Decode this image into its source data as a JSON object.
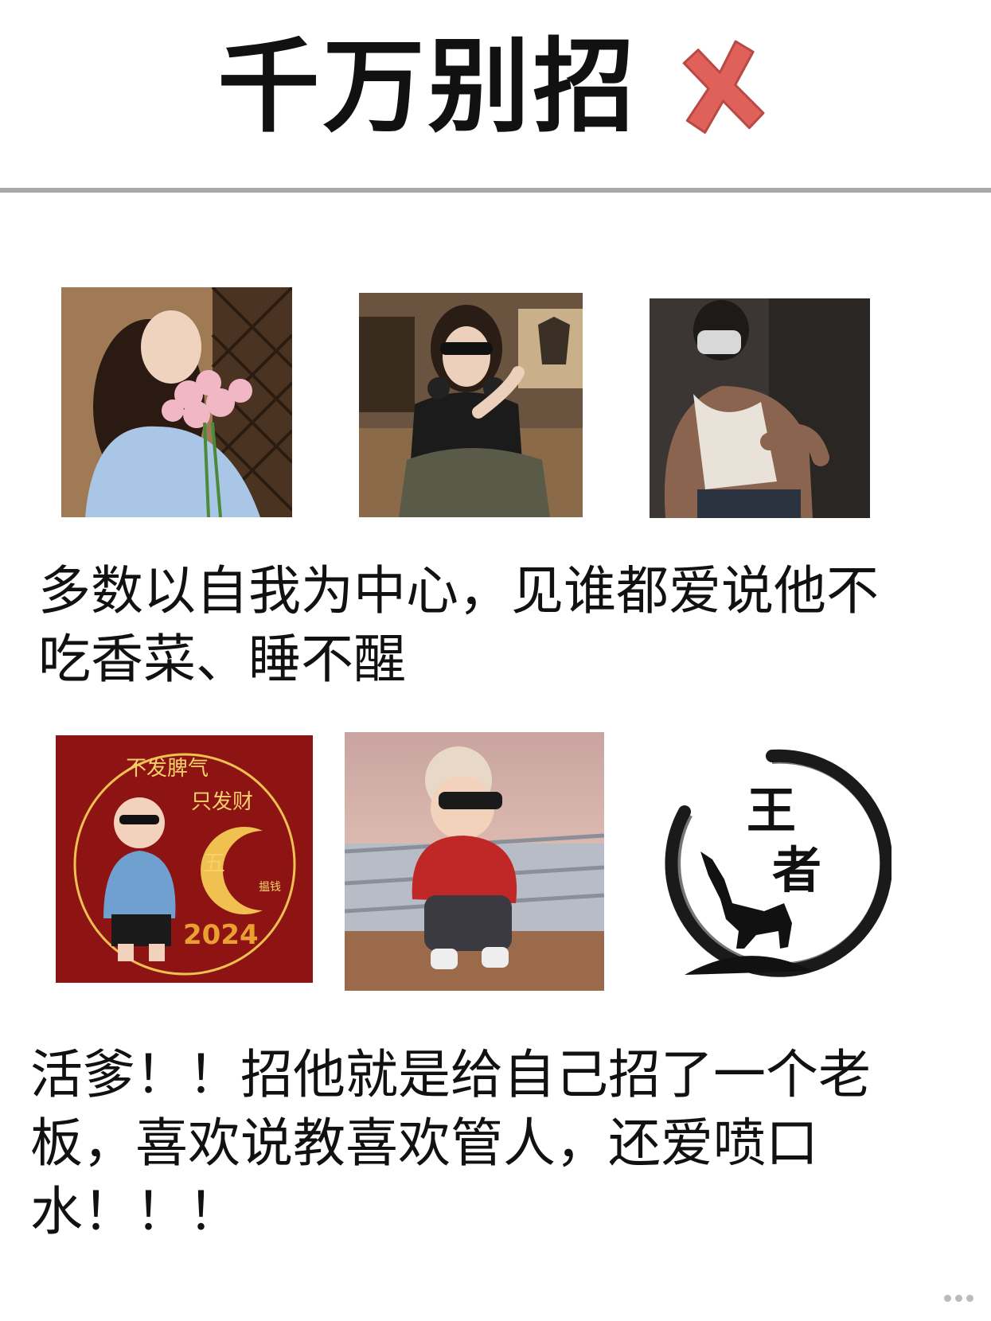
{
  "header": {
    "title": "千万别招",
    "mark_icon": "red-cross-icon",
    "mark_color": "#e0605a"
  },
  "section1": {
    "photos": [
      "woman-with-flowers-photo",
      "woman-with-sunglasses-photo",
      "masked-man-tank-top-photo"
    ],
    "caption": "多数以自我为中心，见谁都爱说他不吃香菜、睡不醒"
  },
  "section2": {
    "photos": [
      {
        "name": "cartoon-boy-new-year-avatar",
        "lines": [
          "不发脾气",
          "只发财"
        ],
        "mark": "五",
        "small": "揾钱",
        "year": "2024"
      },
      {
        "name": "cartoon-boy-yacht-avatar"
      },
      {
        "name": "wolf-ink-circle-avatar",
        "text": [
          "王",
          "者"
        ]
      }
    ],
    "caption": "活爹！！招他就是给自己招了一个老板，喜欢说教喜欢管人，还爱喷口水！！！"
  },
  "colors": {
    "divider": "#a8a8a8",
    "avatar_red": "#8e1414",
    "gold": "#f0c050"
  }
}
